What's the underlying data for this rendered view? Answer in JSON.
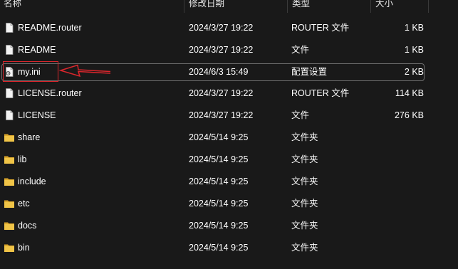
{
  "columns": {
    "name": "名称",
    "date": "修改日期",
    "type": "类型",
    "size": "大小"
  },
  "rows": [
    {
      "name": "README.router",
      "date": "2024/3/27 19:22",
      "type": "ROUTER 文件",
      "size": "1 KB",
      "icon": "file-icon"
    },
    {
      "name": "README",
      "date": "2024/3/27 19:22",
      "type": "文件",
      "size": "1 KB",
      "icon": "file-icon"
    },
    {
      "name": "my.ini",
      "date": "2024/6/3 15:49",
      "type": "配置设置",
      "size": "2 KB",
      "icon": "config-file-icon"
    },
    {
      "name": "LICENSE.router",
      "date": "2024/3/27 19:22",
      "type": "ROUTER 文件",
      "size": "114 KB",
      "icon": "file-icon"
    },
    {
      "name": "LICENSE",
      "date": "2024/3/27 19:22",
      "type": "文件",
      "size": "276 KB",
      "icon": "file-icon"
    },
    {
      "name": "share",
      "date": "2024/5/14 9:25",
      "type": "文件夹",
      "size": "",
      "icon": "folder-icon"
    },
    {
      "name": "lib",
      "date": "2024/5/14 9:25",
      "type": "文件夹",
      "size": "",
      "icon": "folder-icon"
    },
    {
      "name": "include",
      "date": "2024/5/14 9:25",
      "type": "文件夹",
      "size": "",
      "icon": "folder-icon"
    },
    {
      "name": "etc",
      "date": "2024/5/14 9:25",
      "type": "文件夹",
      "size": "",
      "icon": "folder-icon"
    },
    {
      "name": "docs",
      "date": "2024/5/14 9:25",
      "type": "文件夹",
      "size": "",
      "icon": "folder-icon"
    },
    {
      "name": "bin",
      "date": "2024/5/14 9:25",
      "type": "文件夹",
      "size": "",
      "icon": "folder-icon"
    }
  ],
  "selected_row": "my.ini",
  "colors": {
    "background": "#191919",
    "text": "#ffffff",
    "annotation": "#d9262c",
    "folder": "#f0c447",
    "selection_border": "#6f6f6f"
  }
}
